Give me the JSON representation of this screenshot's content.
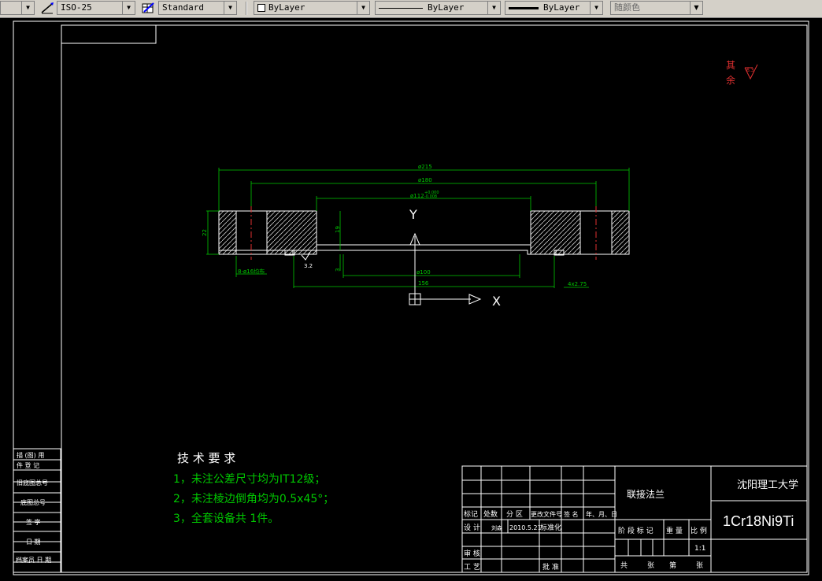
{
  "toolbar": {
    "dimstyle_value": "ISO-25",
    "tablestyle_value": "Standard",
    "layer_color_value": "ByLayer",
    "linetype_value": "ByLayer",
    "lineweight_value": "ByLayer",
    "plotstyle_value": "随颜色"
  },
  "drawing": {
    "dims": {
      "d_outer": "ø215",
      "d_bolt_circle": "ø180",
      "d_bore": "ø112",
      "d_bore_tol": "+0.000\n-0.008",
      "d_bore_tol_upper": "+0.000",
      "d_bore_tol_lower": "-0.008",
      "d_inner": "ø100",
      "w_156": "156",
      "thickness": "22",
      "depth": "19",
      "step": "3",
      "holes": "8-ø16均布",
      "chamfer": "4x2.75",
      "roughness": "3.2"
    },
    "axis_y": "Y",
    "axis_x": "X",
    "surface_note_1": "其",
    "surface_note_2": "余",
    "surface_note_value": "6.3"
  },
  "tech_requirements": {
    "heading": "技 术 要 求",
    "items": [
      "1，未注公差尺寸均为IT12级；",
      "2，未注棱边倒角均为0.5x45°；",
      "3，全套设备共 1件。"
    ]
  },
  "side_block": {
    "rows": [
      "描 (图) 用",
      "件 登 记",
      "旧底图总号",
      "底图总号",
      "签 字",
      "日 期",
      "档案员 日 期"
    ]
  },
  "title_block": {
    "part_name": "联接法兰",
    "school": "沈阳理工大学",
    "material": "1Cr18Ni9Ti",
    "header_row": [
      "标记",
      "处数",
      "分 区",
      "更改文件号",
      "签 名",
      "年、月、日"
    ],
    "design_label": "设 计",
    "designer": "刘森",
    "date": "2010.5.21",
    "std_label": "标准化",
    "review_label": "审 核",
    "process_label": "工 艺",
    "approve_label": "批 准",
    "stage_labels": [
      "阶 段 标 记",
      "重 量",
      "比 例"
    ],
    "scale": "1:1",
    "sheets_label": [
      "共",
      "张",
      "第",
      "张"
    ]
  }
}
